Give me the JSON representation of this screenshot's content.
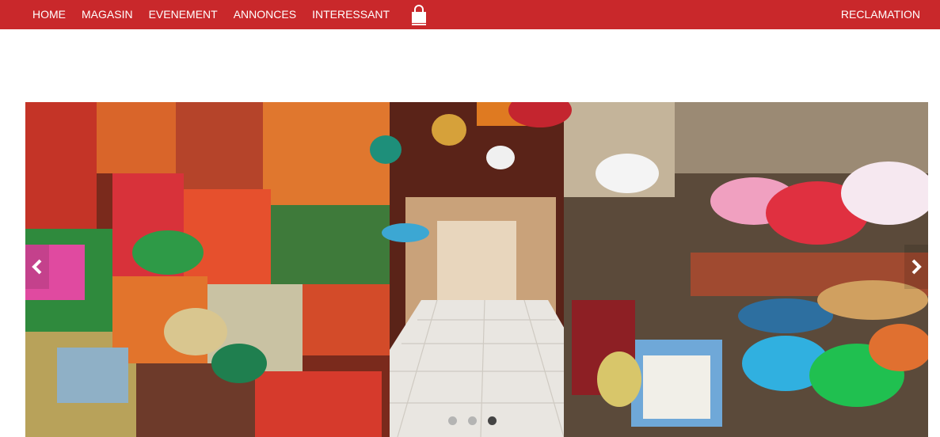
{
  "navbar": {
    "items": [
      {
        "label": "HOME"
      },
      {
        "label": "MAGASIN"
      },
      {
        "label": "EVENEMENT"
      },
      {
        "label": "ANNONCES"
      },
      {
        "label": "INTERESSANT"
      }
    ],
    "cart_icon": "shopping-bag-icon",
    "right_label": "RECLAMATION",
    "background_color": "#c9282b",
    "text_color": "#ffffff"
  },
  "carousel": {
    "slide_image": "souk-market-bags-and-lamps",
    "prev_icon": "chevron-left-icon",
    "next_icon": "chevron-right-icon",
    "indicator_count": 3,
    "active_indicator": 3
  }
}
